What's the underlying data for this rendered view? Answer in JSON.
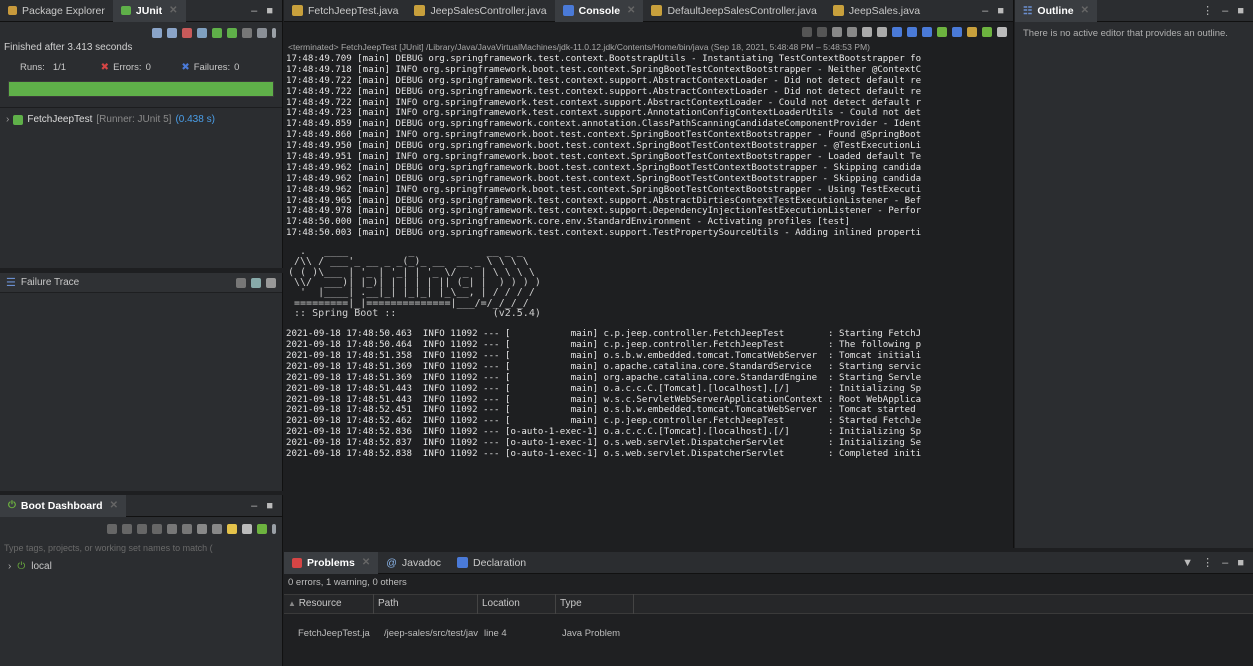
{
  "left_top": {
    "tabs": [
      "Package Explorer",
      "JUnit"
    ],
    "finished": "Finished after 3.413 seconds",
    "runs_label": "Runs:",
    "runs_value": "1/1",
    "errors_label": "Errors:",
    "errors_value": "0",
    "failures_label": "Failures:",
    "failures_value": "0",
    "progress": 1.0,
    "progress_color": "#5fb049",
    "test_name": "FetchJeepTest",
    "test_runner": "[Runner: JUnit 5]",
    "test_time": "(0.438 s)"
  },
  "failure_trace": {
    "title": "Failure Trace"
  },
  "boot_dashboard": {
    "title": "Boot Dashboard",
    "filter_placeholder": "Type tags, projects, or working set names to match (",
    "item": "local"
  },
  "editor_tabs": [
    "FetchJeepTest.java",
    "JeepSalesController.java",
    "Console",
    "DefaultJeepSalesController.java",
    "JeepSales.java"
  ],
  "console": {
    "terminated": "<terminated> FetchJeepTest [JUnit] /Library/Java/JavaVirtualMachines/jdk-11.0.12.jdk/Contents/Home/bin/java  (Sep 18, 2021, 5:48:48 PM – 5:48:53 PM)",
    "lines": [
      "17:48:49.709 [main] DEBUG org.springframework.test.context.BootstrapUtils - Instantiating TestContextBootstrapper fo",
      "17:48:49.718 [main] INFO org.springframework.boot.test.context.SpringBootTestContextBootstrapper - Neither @ContextC",
      "17:48:49.722 [main] DEBUG org.springframework.test.context.support.AbstractContextLoader - Did not detect default re",
      "17:48:49.722 [main] DEBUG org.springframework.test.context.support.AbstractContextLoader - Did not detect default re",
      "17:48:49.722 [main] INFO org.springframework.test.context.support.AbstractContextLoader - Could not detect default r",
      "17:48:49.723 [main] INFO org.springframework.test.context.support.AnnotationConfigContextLoaderUtils - Could not det",
      "17:48:49.859 [main] DEBUG org.springframework.context.annotation.ClassPathScanningCandidateComponentProvider - Ident",
      "17:48:49.860 [main] INFO org.springframework.boot.test.context.SpringBootTestContextBootstrapper - Found @SpringBoot",
      "17:48:49.950 [main] DEBUG org.springframework.boot.test.context.SpringBootTestContextBootstrapper - @TestExecutionLi",
      "17:48:49.951 [main] INFO org.springframework.boot.test.context.SpringBootTestContextBootstrapper - Loaded default Te",
      "17:48:49.962 [main] DEBUG org.springframework.boot.test.context.SpringBootTestContextBootstrapper - Skipping candida",
      "17:48:49.962 [main] DEBUG org.springframework.boot.test.context.SpringBootTestContextBootstrapper - Skipping candida",
      "17:48:49.962 [main] INFO org.springframework.boot.test.context.SpringBootTestContextBootstrapper - Using TestExecuti",
      "17:48:49.965 [main] DEBUG org.springframework.test.context.support.AbstractDirtiesContextTestExecutionListener - Bef",
      "17:48:49.978 [main] DEBUG org.springframework.test.context.support.DependencyInjectionTestExecutionListener - Perfor",
      "17:48:50.000 [main] DEBUG org.springframework.core.env.StandardEnvironment - Activating profiles [test]",
      "17:48:50.003 [main] DEBUG org.springframework.test.context.support.TestPropertySourceUtils - Adding inlined properti"
    ],
    "banner": [
      "  .   ____          _            __ _ _",
      " /\\\\ / ___'_ __ _ _(_)_ __  __ _ \\ \\ \\ \\",
      "( ( )\\___ | '_ | '_| | '_ \\/ _` | \\ \\ \\ \\",
      " \\\\/  ___)| |_)| | | | | || (_| |  ) ) ) )",
      "  '  |____| .__|_| |_|_| |_\\__, | / / / /",
      " =========|_|==============|___/=/_/_/_/",
      " :: Spring Boot ::                (v2.5.4)"
    ],
    "log": [
      "2021-09-18 17:48:50.463  INFO 11092 --- [           main] c.p.jeep.controller.FetchJeepTest        : Starting FetchJ",
      "2021-09-18 17:48:50.464  INFO 11092 --- [           main] c.p.jeep.controller.FetchJeepTest        : The following p",
      "2021-09-18 17:48:51.358  INFO 11092 --- [           main] o.s.b.w.embedded.tomcat.TomcatWebServer  : Tomcat initiali",
      "2021-09-18 17:48:51.369  INFO 11092 --- [           main] o.apache.catalina.core.StandardService   : Starting servic",
      "2021-09-18 17:48:51.369  INFO 11092 --- [           main] org.apache.catalina.core.StandardEngine  : Starting Servle",
      "2021-09-18 17:48:51.443  INFO 11092 --- [           main] o.a.c.c.C.[Tomcat].[localhost].[/]       : Initializing Sp",
      "2021-09-18 17:48:51.443  INFO 11092 --- [           main] w.s.c.ServletWebServerApplicationContext : Root WebApplica",
      "2021-09-18 17:48:52.451  INFO 11092 --- [           main] o.s.b.w.embedded.tomcat.TomcatWebServer  : Tomcat started",
      "2021-09-18 17:48:52.462  INFO 11092 --- [           main] c.p.jeep.controller.FetchJeepTest        : Started FetchJe",
      "2021-09-18 17:48:52.836  INFO 11092 --- [o-auto-1-exec-1] o.a.c.c.C.[Tomcat].[localhost].[/]       : Initializing Sp",
      "2021-09-18 17:48:52.837  INFO 11092 --- [o-auto-1-exec-1] o.s.web.servlet.DispatcherServlet        : Initializing Se",
      "2021-09-18 17:48:52.838  INFO 11092 --- [o-auto-1-exec-1] o.s.web.servlet.DispatcherServlet        : Completed initi"
    ]
  },
  "outline": {
    "title": "Outline",
    "message": "There is no active editor that provides an outline."
  },
  "problems": {
    "tabs": [
      "Problems",
      "Javadoc",
      "Declaration"
    ],
    "summary": "0 errors, 1 warning, 0 others",
    "columns": [
      "Resource",
      "Path",
      "Location",
      "Type"
    ],
    "row": {
      "resource": "FetchJeepTest.ja",
      "path": "/jeep-sales/src/test/jav",
      "location": "line 4",
      "type": "Java Problem"
    }
  },
  "colors": {
    "junit_green": "#5fb049",
    "error_red": "#d64545",
    "failure_blue": "#4a7ad8",
    "link_blue": "#4a9ee8"
  }
}
